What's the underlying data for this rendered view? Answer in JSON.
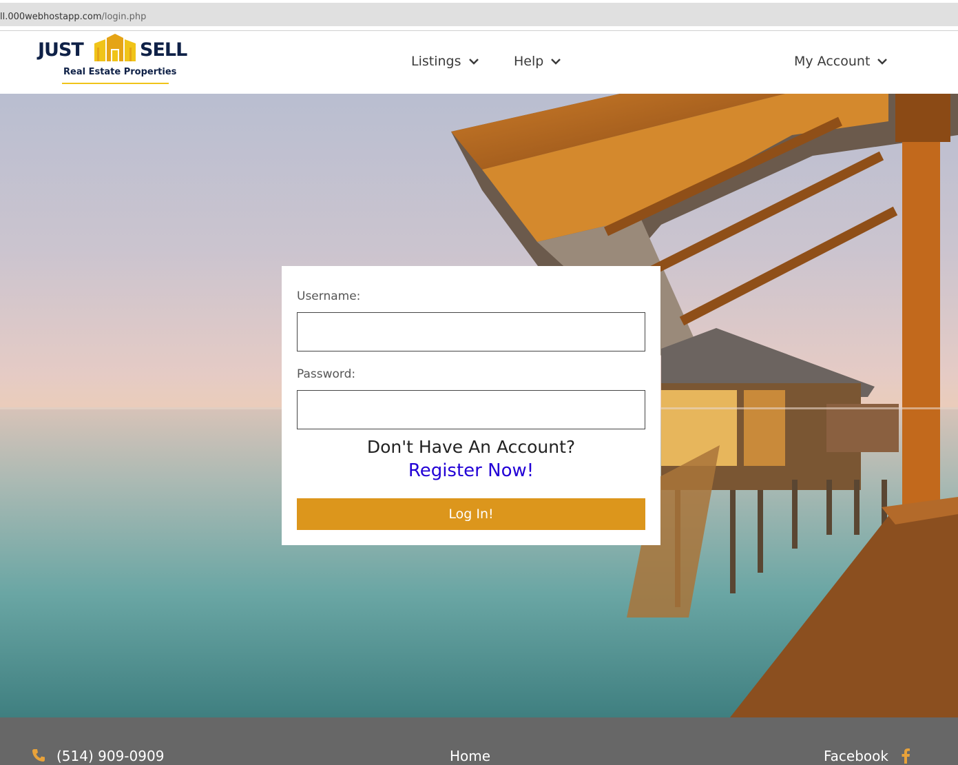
{
  "browser": {
    "url_host": "ll.000webhostapp.com",
    "url_path": "/login.php"
  },
  "header": {
    "logo": {
      "word_left": "JUST",
      "word_right": "SELL",
      "subtitle": "Real Estate Properties"
    },
    "nav": [
      {
        "label": "Listings",
        "icon": "chevron-down-icon"
      },
      {
        "label": "Help",
        "icon": "chevron-down-icon"
      },
      {
        "label": "My Account",
        "icon": "chevron-down-icon"
      }
    ]
  },
  "login": {
    "username_label": "Username:",
    "username_value": "",
    "password_label": "Password:",
    "password_value": "",
    "no_account_text": "Don't Have An Account?",
    "register_link": "Register Now!",
    "submit_label": "Log In!"
  },
  "footer": {
    "phone": "(514) 909-0909",
    "phone_icon": "phone-icon",
    "home_link": "Home",
    "facebook_link": "Facebook",
    "facebook_icon": "facebook-icon"
  },
  "colors": {
    "brand_navy": "#0f2147",
    "brand_gold": "#f0c419",
    "button": "#dc961c",
    "link": "#2200d6",
    "footer_bg": "#676767"
  }
}
